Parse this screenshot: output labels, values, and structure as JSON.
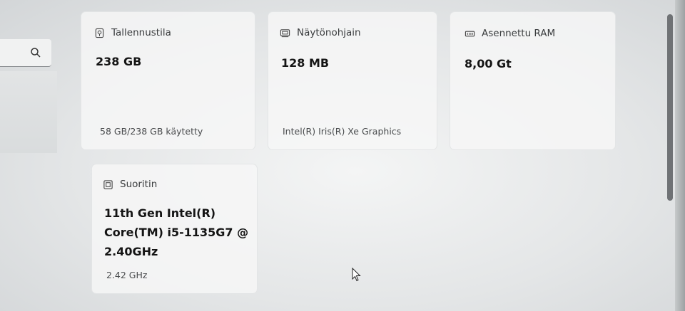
{
  "search": {
    "icon": "search-icon"
  },
  "cards": {
    "storage": {
      "title": "Tallennustila",
      "icon": "storage-icon",
      "value": "238 GB",
      "detail": "58 GB/238 GB käytetty"
    },
    "gpu": {
      "title": "Näytönohjain",
      "icon": "display-adapter-icon",
      "value": "128 MB",
      "detail": "Intel(R) Iris(R) Xe Graphics"
    },
    "ram": {
      "title": "Asennettu RAM",
      "icon": "memory-icon",
      "value": "8,00 Gt"
    },
    "cpu": {
      "title": "Suoritin",
      "icon": "processor-icon",
      "value_lines": [
        "11th Gen Intel(R)",
        "Core(TM) i5-1135G7 @",
        "2.40GHz"
      ],
      "detail": "2.42 GHz"
    }
  }
}
